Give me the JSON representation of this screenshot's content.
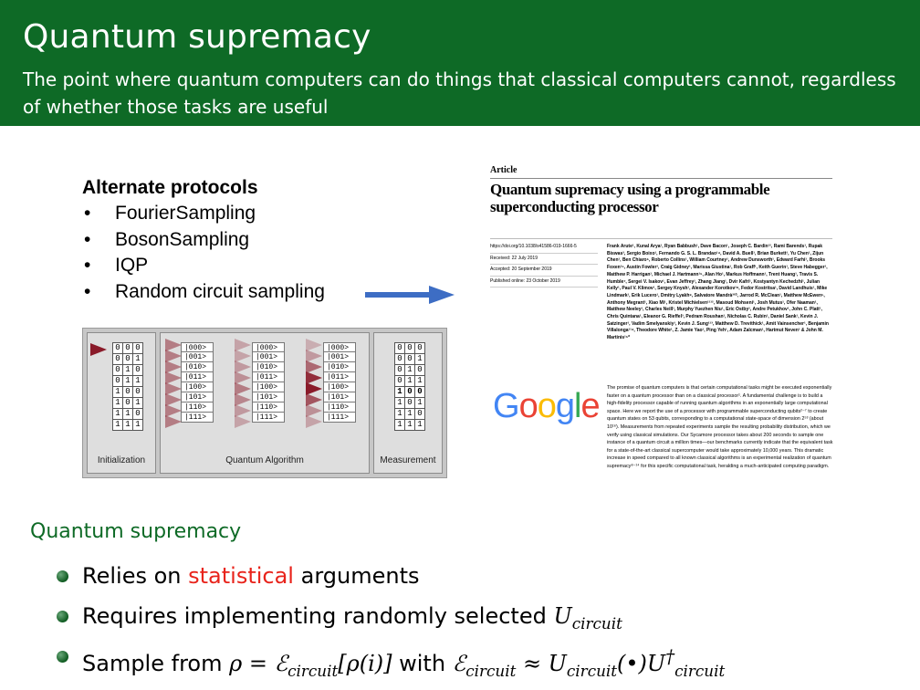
{
  "header": {
    "title": "Quantum supremacy",
    "subtitle": "The point where quantum computers can do things that classical computers cannot, regardless of whether those tasks are useful"
  },
  "protocols": {
    "title": "Alternate protocols",
    "items": [
      "FourierSampling",
      "BosonSampling",
      "IQP",
      "Random circuit sampling"
    ]
  },
  "circuit_figure": {
    "labels": {
      "init": "Initialization",
      "algo": "Quantum Algorithm",
      "measure": "Measurement"
    },
    "bits": [
      [
        "0",
        "0",
        "0"
      ],
      [
        "0",
        "0",
        "1"
      ],
      [
        "0",
        "1",
        "0"
      ],
      [
        "0",
        "1",
        "1"
      ],
      [
        "1",
        "0",
        "0"
      ],
      [
        "1",
        "0",
        "1"
      ],
      [
        "1",
        "1",
        "0"
      ],
      [
        "1",
        "1",
        "1"
      ]
    ],
    "kets": [
      "|000>",
      "|001>",
      "|010>",
      "|011>",
      "|100>",
      "|101>",
      "|110>",
      "|111>"
    ]
  },
  "paper": {
    "kind": "Article",
    "title": "Quantum supremacy using a programmable superconducting processor",
    "doi": "https://doi.org/10.1038/s41586-019-1666-5",
    "received": "Received: 22 July 2019",
    "accepted": "Accepted: 20 September 2019",
    "published": "Published online: 23 October 2019",
    "authors": "Frank Arute¹, Kunal Arya¹, Ryan Babbush¹, Dave Bacon¹, Joseph C. Bardin¹², Rami Barends¹, Rupak Biswas³, Sergio Boixo¹, Fernando G. S. L. Brandao¹⁴, David A. Buell¹, Brian Burkett¹, Yu Chen¹, Zijun Chen¹, Ben Chiaro⁵, Roberto Collins¹, William Courtney¹, Andrew Dunsworth¹, Edward Farhi¹, Brooks Foxen¹⁵, Austin Fowler¹, Craig Gidney¹, Marissa Giustina¹, Rob Graff¹, Keith Guerin¹, Steve Habegger¹, Matthew P. Harrigan¹, Michael J. Hartmann¹⁶, Alan Ho¹, Markus Hoffmann¹, Trent Huang¹, Travis S. Humble⁷, Sergei V. Isakov¹, Evan Jeffrey¹, Zhang Jiang¹, Dvir Kafri¹, Kostyantyn Kechedzhi¹, Julian Kelly¹, Paul V. Klimov¹, Sergey Knysh¹, Alexander Korotkov¹⁸, Fedor Kostritsa¹, David Landhuis¹, Mike Lindmark¹, Erik Lucero¹, Dmitry Lyakh⁹, Salvatore Mandrà³¹⁰, Jarrod R. McClean¹, Matthew McEwen⁵, Anthony Megrant¹, Xiao Mi¹, Kristel Michielsen¹¹¹², Masoud Mohseni¹, Josh Mutus¹, Ofer Naaman¹, Matthew Neeley¹, Charles Neill¹, Murphy Yuezhen Niu¹, Eric Ostby¹, Andre Petukhov¹, John C. Platt¹, Chris Quintana¹, Eleanor G. Rieffel³, Pedram Roushan¹, Nicholas C. Rubin¹, Daniel Sank¹, Kevin J. Satzinger¹, Vadim Smelyanskiy¹, Kevin J. Sung¹¹³, Matthew D. Trevithick¹, Amit Vainsencher¹, Benjamin Villalonga¹¹⁴, Theodore White¹, Z. Jamie Yao¹, Ping Yeh¹, Adam Zalcman¹, Hartmut Neven¹ & John M. Martinis¹⁵*",
    "abstract": "The promise of quantum computers is that certain computational tasks might be executed exponentially faster on a quantum processor than on a classical processor¹. A fundamental challenge is to build a high-fidelity processor capable of running quantum algorithms in an exponentially large computational space. Here we report the use of a processor with programmable superconducting qubits²⁻⁷ to create quantum states on 53 qubits, corresponding to a computational state-space of dimension 2⁵³ (about 10¹⁶). Measurements from repeated experiments sample the resulting probability distribution, which we verify using classical simulations. Our Sycamore processor takes about 200 seconds to sample one instance of a quantum circuit a million times—our benchmarks currently indicate that the equivalent task for a state-of-the-art classical supercomputer would take approximately 10,000 years. This dramatic increase in speed compared to all known classical algorithms is an experimental realization of quantum supremacy⁸⁻¹⁴ for this specific computational task, heralding a much-anticipated computing paradigm.",
    "logo": "Google"
  },
  "section": {
    "title": "Quantum supremacy",
    "b1_pre": "Relies on ",
    "b1_red": "statistical",
    "b1_post": " arguments",
    "b2_text": "Requires implementing randomly selected ",
    "b3_pre": "Sample from ",
    "b3_with": " with "
  },
  "colors": {
    "header_bg": "#0e6a26",
    "accent_red": "#e8231b",
    "arrow": "#3d6dc4",
    "triangle": "#8a1b2a"
  }
}
